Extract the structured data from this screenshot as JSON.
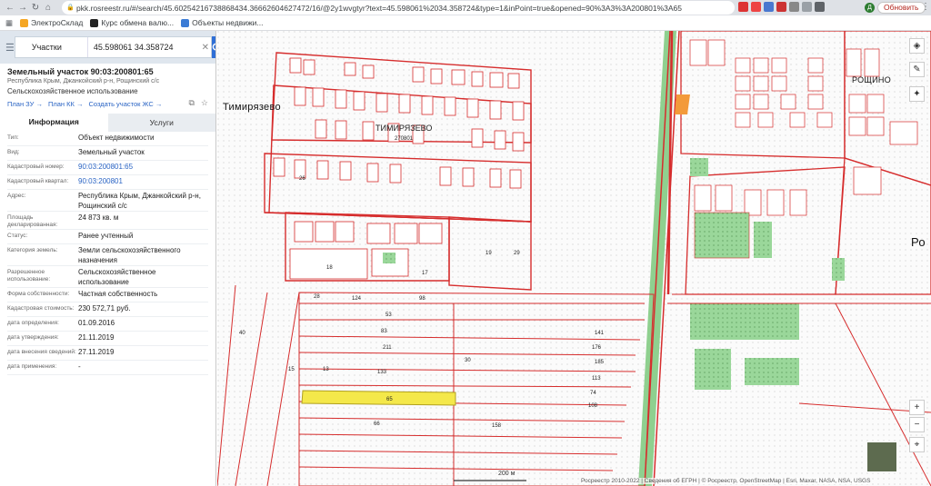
{
  "browser": {
    "url": "pkk.rosreestr.ru/#/search/45.60254216738868434.366626046274​72/16/@2y1wvgtyr?text=45.598061%2034.358724&type=1&inPoint=true&opened=90%3A3%3A200801%3A65",
    "update_label": "Обновить",
    "avatar_letter": "Д",
    "bookmarks": [
      "ЭлектроСклад",
      "Курс обмена валю...",
      "Объекты недвижи..."
    ]
  },
  "search": {
    "type_label": "Участки",
    "value": "45.598061 34.358724"
  },
  "object": {
    "title": "Земельный участок 90:03:200801:65",
    "address_short": "Республика Крым, Джанкойский р-н, Рощинский с/с",
    "usage": "Сельскохозяйственное использование",
    "links": [
      "План ЗУ →",
      "План КК →",
      "Создать участок ЖС →"
    ]
  },
  "tabs": [
    "Информация",
    "Услуги"
  ],
  "info_rows": [
    {
      "label": "Тип:",
      "value": "Объект недвижимости"
    },
    {
      "label": "Вид:",
      "value": "Земельный участок"
    },
    {
      "label": "Кадастровый номер:",
      "value": "90:03:200801:65",
      "link": true
    },
    {
      "label": "Кадастровый квартал:",
      "value": "90:03:200801",
      "link": true
    },
    {
      "label": "Адрес:",
      "value": "Республика Крым, Джанкойский р-н, Рощинский с/с"
    },
    {
      "label": "Площадь декларированная:",
      "value": "24 873 кв. м"
    },
    {
      "label": "Статус:",
      "value": "Ранее учтенный"
    },
    {
      "label": "Категория земель:",
      "value": "Земли сельскохозяйственного назначения"
    },
    {
      "label": "Разрешенное использование:",
      "value": "Сельскохозяйственное использование"
    },
    {
      "label": "Форма собственности:",
      "value": "Частная собственность"
    },
    {
      "label": "Кадастровая стоимость:",
      "value": "230 572,71 руб."
    },
    {
      "label": "дата определения:",
      "value": "01.09.2016"
    },
    {
      "label": "дата утверждения:",
      "value": "21.11.2019"
    },
    {
      "label": "дата внесения сведений:",
      "value": "27.11.2019"
    },
    {
      "label": "дата применения:",
      "value": "-"
    }
  ],
  "map": {
    "towns": [
      "Тимирязево",
      "ТИМИРЯЗЕВО",
      "РОЩИНО",
      "Ро"
    ],
    "village_code": "270801",
    "scale_label": "200 м",
    "attribution": "Росреестр 2010-2022 | Сведения об ЕГРН | © Росреестр, OpenStreetMap | Esri, Maxar, NASA, NSA, USGS",
    "parcel_labels": [
      "124",
      "98",
      "53",
      "141",
      "83",
      "176",
      "211",
      "185",
      "113",
      "74",
      "108",
      "158",
      "66",
      "65",
      "18",
      "29",
      "26",
      "19",
      "17",
      "15",
      "13",
      "133",
      "30",
      "40",
      "28"
    ],
    "zoom_in": "+",
    "zoom_out": "−"
  },
  "colors": {
    "boundary": "#d62d2d",
    "highlight": "#f4e84a",
    "road": "#7ec987",
    "green_area": "#9ad79a",
    "accent": "#2f6fd6"
  }
}
